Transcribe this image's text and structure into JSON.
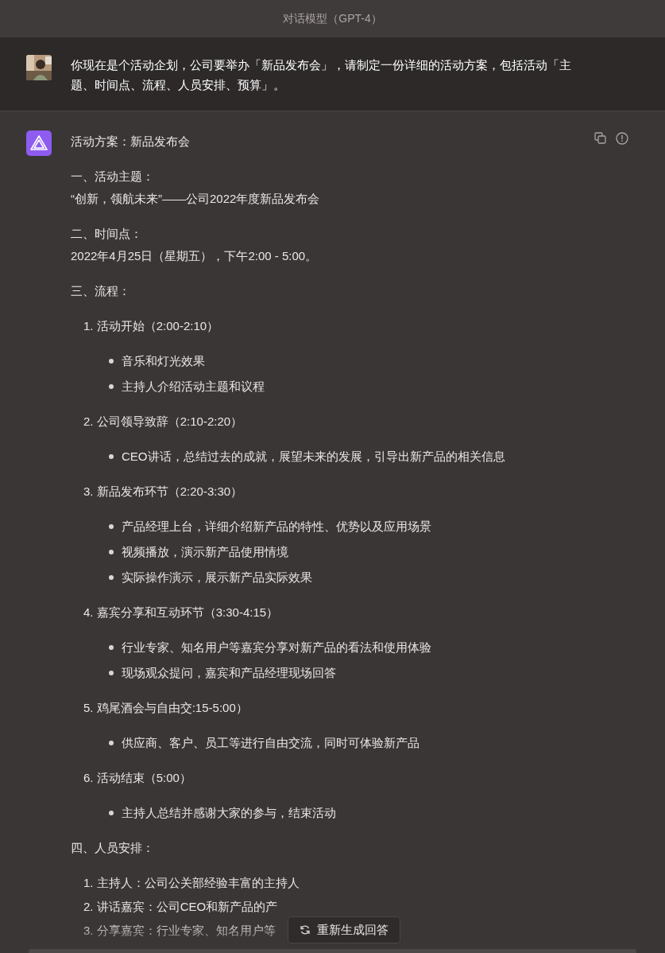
{
  "header": {
    "title": "对话模型（GPT-4）"
  },
  "user_message": {
    "text": "你现在是个活动企划，公司要举办「新品发布会」，请制定一份详细的活动方案，包括活动「主题、时间点、流程、人员安排、预算」。"
  },
  "assistant_message": {
    "blocks": [
      {
        "kind": "paragraph",
        "lines": [
          "活动方案：新品发布会"
        ]
      },
      {
        "kind": "paragraph",
        "lines": [
          "一、活动主题：",
          "“创新，领航未来”——公司2022年度新品发布会"
        ]
      },
      {
        "kind": "paragraph",
        "lines": [
          "二、时间点：",
          "2022年4月25日（星期五），下午2:00 - 5:00。"
        ]
      },
      {
        "kind": "paragraph",
        "lines": [
          "三、流程："
        ]
      },
      {
        "kind": "ordered",
        "items": [
          {
            "number": "1.",
            "text": "活动开始（2:00-2:10）",
            "children": [
              "音乐和灯光效果",
              "主持人介绍活动主题和议程"
            ]
          },
          {
            "number": "2.",
            "text": "公司领导致辞（2:10-2:20）",
            "children": [
              "CEO讲话，总结过去的成就，展望未来的发展，引导出新产品的相关信息"
            ]
          },
          {
            "number": "3.",
            "text": "新品发布环节（2:20-3:30）",
            "children": [
              "产品经理上台，详细介绍新产品的特性、优势以及应用场景",
              "视频播放，演示新产品使用情境",
              "实际操作演示，展示新产品实际效果"
            ]
          },
          {
            "number": "4.",
            "text": "嘉宾分享和互动环节（3:30-4:15）",
            "children": [
              "行业专家、知名用户等嘉宾分享对新产品的看法和使用体验",
              "现场观众提问，嘉宾和产品经理现场回答"
            ]
          },
          {
            "number": "5.",
            "text": "鸡尾酒会与自由交:15-5:00）",
            "children": [
              "供应商、客户、员工等进行自由交流，同时可体验新产品"
            ]
          },
          {
            "number": "6.",
            "text": "活动结束（5:00）",
            "children": [
              "主持人总结并感谢大家的参与，结束活动"
            ]
          }
        ]
      },
      {
        "kind": "paragraph",
        "lines": [
          "四、人员安排："
        ]
      },
      {
        "kind": "ordered",
        "items": [
          {
            "number": "1.",
            "text": "主持人：公司公关部经验丰富的主持人"
          },
          {
            "number": "2.",
            "text": "讲话嘉宾：公司CEO和新产品的产"
          },
          {
            "number": "3.",
            "text": "分享嘉宾：行业专家、知名用户等"
          }
        ]
      }
    ]
  },
  "regenerate_button": {
    "label": "重新生成回答"
  }
}
